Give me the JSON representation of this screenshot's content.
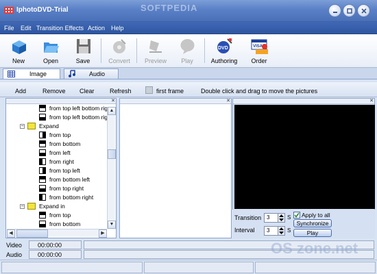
{
  "window": {
    "title": "IphotoDVD-Trial",
    "watermark": "SOFTPEDIA",
    "bottom_watermark": "OS zone.net"
  },
  "menu": [
    {
      "label": "File"
    },
    {
      "label": "Edit"
    },
    {
      "label": "Transition Effects"
    },
    {
      "label": "Action"
    },
    {
      "label": "Help"
    }
  ],
  "toolbar": {
    "new": "New",
    "open": "Open",
    "save": "Save",
    "convert": "Convert",
    "preview": "Preview",
    "play": "Play",
    "authoring": "Authoring",
    "order": "Order"
  },
  "tabs": {
    "image": "Image",
    "audio": "Audio"
  },
  "actions": {
    "add": "Add",
    "remove": "Remove",
    "clear": "Clear",
    "refresh": "Refresh",
    "first_frame": "first frame",
    "hint": "Double click and drag to move the pictures"
  },
  "tree": [
    {
      "label": "from top left bottom rig",
      "kind": "item"
    },
    {
      "label": "from top left bottom rig",
      "kind": "item"
    },
    {
      "label": "Expand",
      "kind": "folder"
    },
    {
      "label": "from top",
      "kind": "item"
    },
    {
      "label": "from bottom",
      "kind": "item"
    },
    {
      "label": "from left",
      "kind": "item"
    },
    {
      "label": "from right",
      "kind": "item"
    },
    {
      "label": "from top left",
      "kind": "item"
    },
    {
      "label": "from bottom left",
      "kind": "item"
    },
    {
      "label": "from top right",
      "kind": "item"
    },
    {
      "label": "from bottom right",
      "kind": "item"
    },
    {
      "label": "Expand in",
      "kind": "folder"
    },
    {
      "label": "from top",
      "kind": "item"
    },
    {
      "label": "from bottom",
      "kind": "item"
    }
  ],
  "settings": {
    "transition_label": "Transition",
    "transition_value": "3",
    "transition_unit": "S",
    "interval_label": "Interval",
    "interval_value": "3",
    "interval_unit": "S",
    "apply_to_all": "Apply to all",
    "apply_checked": true,
    "synchronize": "Synchronize",
    "play": "Play"
  },
  "timeline": {
    "video_label": "Video",
    "video_time": "00:00:00",
    "audio_label": "Audio",
    "audio_time": "00:00:00"
  },
  "colors": {
    "title_blue": "#5a80c6",
    "menu_blue": "#2f56a0",
    "preview_bg": "#000000"
  }
}
